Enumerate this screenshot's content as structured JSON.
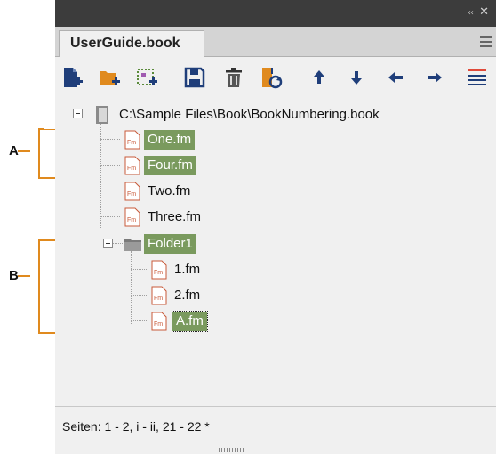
{
  "panel": {
    "tab_title": "UserGuide.book",
    "accent_color": "#e08a1e",
    "selection_color": "#7a9a5e"
  },
  "toolbar": {
    "buttons": [
      {
        "name": "add-file-icon"
      },
      {
        "name": "add-folder-icon"
      },
      {
        "name": "add-group-icon"
      },
      {
        "name": "save-icon"
      },
      {
        "name": "delete-icon"
      },
      {
        "name": "update-book-icon"
      },
      {
        "name": "move-up-icon"
      },
      {
        "name": "move-down-icon"
      },
      {
        "name": "demote-left-icon"
      },
      {
        "name": "promote-right-icon"
      },
      {
        "name": "list-options-icon"
      }
    ]
  },
  "tree": {
    "book": {
      "label": "C:\\Sample Files\\Book\\BookNumbering.book"
    },
    "items": [
      {
        "label": "One.fm",
        "selected": true
      },
      {
        "label": "Four.fm",
        "selected": true
      },
      {
        "label": "Two.fm",
        "selected": false
      },
      {
        "label": "Three.fm",
        "selected": false
      }
    ],
    "folder": {
      "label": "Folder1",
      "selected": true,
      "children": [
        {
          "label": "1.fm",
          "selected": false
        },
        {
          "label": "2.fm",
          "selected": false
        },
        {
          "label": "A.fm",
          "selected": true
        }
      ]
    }
  },
  "status": {
    "text": "Seiten: 1 - 2, i - ii, 21 - 22 *"
  },
  "callouts": {
    "a": "A",
    "b": "B"
  }
}
